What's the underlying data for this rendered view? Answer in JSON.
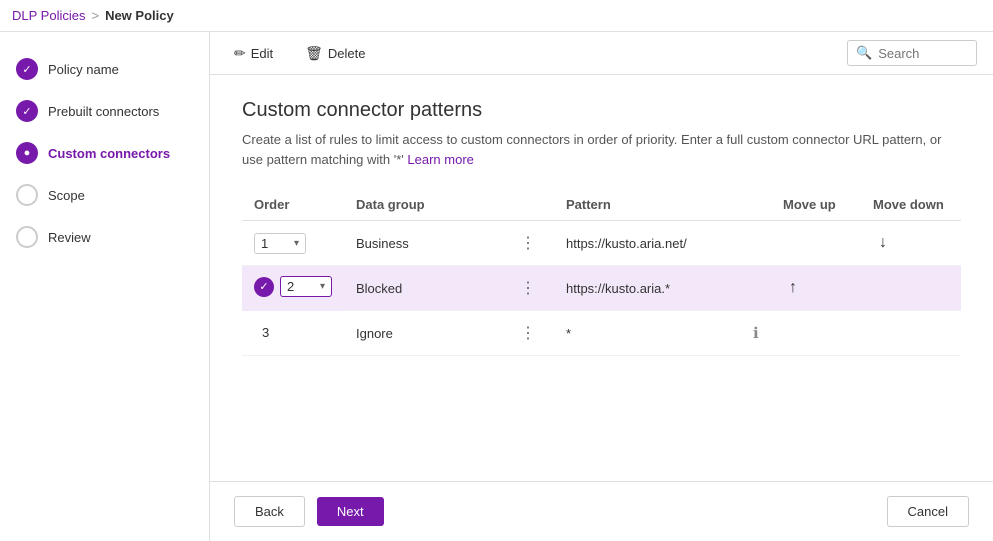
{
  "topbar": {
    "breadcrumb_link": "DLP Policies",
    "breadcrumb_sep": ">",
    "current_page": "New Policy"
  },
  "sidebar": {
    "items": [
      {
        "id": "policy-name",
        "label": "Policy name",
        "state": "completed",
        "icon": "✓"
      },
      {
        "id": "prebuilt-connectors",
        "label": "Prebuilt connectors",
        "state": "completed",
        "icon": "✓"
      },
      {
        "id": "custom-connectors",
        "label": "Custom connectors",
        "state": "active",
        "icon": "●"
      },
      {
        "id": "scope",
        "label": "Scope",
        "state": "pending",
        "icon": ""
      },
      {
        "id": "review",
        "label": "Review",
        "state": "pending",
        "icon": ""
      }
    ]
  },
  "toolbar": {
    "edit_label": "Edit",
    "delete_label": "Delete",
    "search_placeholder": "Search"
  },
  "page": {
    "title": "Custom connector patterns",
    "description": "Create a list of rules to limit access to custom connectors in order of priority. Enter a full custom connector URL pattern, or use pattern matching with '*'",
    "learn_more": "Learn more"
  },
  "table": {
    "columns": [
      "Order",
      "Data group",
      "",
      "Pattern",
      "",
      "Move up",
      "Move down"
    ],
    "rows": [
      {
        "order": "1",
        "data_group": "Business",
        "pattern": "https://kusto.aria.net/",
        "move_up": false,
        "move_down": true,
        "selected": false
      },
      {
        "order": "2",
        "data_group": "Blocked",
        "pattern": "https://kusto.aria.*",
        "move_up": true,
        "move_down": false,
        "selected": true
      },
      {
        "order": "3",
        "data_group": "Ignore",
        "pattern": "*",
        "move_up": false,
        "move_down": false,
        "selected": false,
        "info": true
      }
    ]
  },
  "footer": {
    "back_label": "Back",
    "next_label": "Next",
    "cancel_label": "Cancel"
  }
}
